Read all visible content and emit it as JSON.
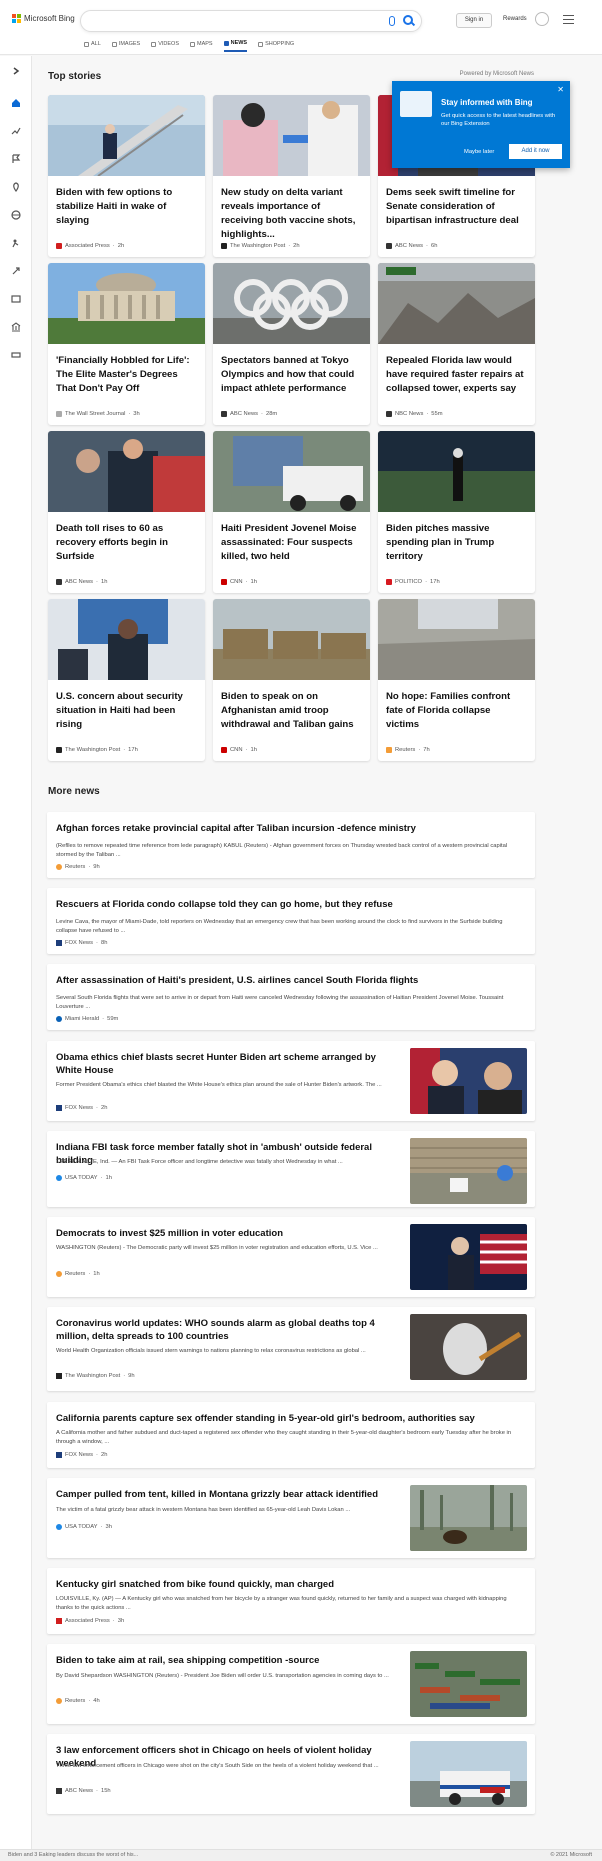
{
  "header": {
    "brand": "Microsoft Bing",
    "signin_label": "Sign in",
    "rewards_label": "Rewards",
    "tabs": [
      {
        "label": "ALL",
        "icon": "search-icon"
      },
      {
        "label": "IMAGES",
        "icon": "image-icon"
      },
      {
        "label": "VIDEOS",
        "icon": "video-icon"
      },
      {
        "label": "MAPS",
        "icon": "map-pin-icon"
      },
      {
        "label": "NEWS",
        "icon": "news-icon"
      },
      {
        "label": "SHOPPING",
        "icon": "tag-icon"
      }
    ],
    "active_tab": "NEWS"
  },
  "top_stories": {
    "title": "Top stories",
    "powered": "Powered by Microsoft News",
    "cards": [
      {
        "title": "Biden with few options to stabilize Haiti in wake of slaying",
        "source": "Associated Press",
        "age": "2h",
        "logo_color": "#d11e1e"
      },
      {
        "title": "New study on delta variant reveals importance of receiving both vaccine shots, highlights...",
        "source": "The Washington Post",
        "age": "2h",
        "logo_color": "#222222"
      },
      {
        "title": "Dems seek swift timeline for Senate consideration of bipartisan infrastructure deal",
        "source": "ABC News",
        "age": "6h",
        "logo_color": "#333333"
      },
      {
        "title": "'Financially Hobbled for Life': The Elite Master's Degrees That Don't Pay Off",
        "source": "The Wall Street Journal",
        "age": "3h",
        "logo_color": "#aaaaaa"
      },
      {
        "title": "Spectators banned at Tokyo Olympics and how that could impact athlete performance",
        "source": "ABC News",
        "age": "28m",
        "logo_color": "#333333"
      },
      {
        "title": "Repealed Florida law would have required faster repairs at collapsed tower, experts say",
        "source": "NBC News",
        "age": "55m",
        "logo_color": "#333333"
      },
      {
        "title": "Death toll rises to 60 as recovery efforts begin in Surfside",
        "source": "ABC News",
        "age": "1h",
        "logo_color": "#333333"
      },
      {
        "title": "Haiti President Jovenel Moise assassinated: Four suspects killed, two held",
        "source": "CNN",
        "age": "1h",
        "logo_color": "#cc0000"
      },
      {
        "title": "Biden pitches massive spending plan in Trump territory",
        "source": "POLITICO",
        "age": "17h",
        "logo_color": "#d71920"
      },
      {
        "title": "U.S. concern about security situation in Haiti had been rising",
        "source": "The Washington Post",
        "age": "17h",
        "logo_color": "#222222"
      },
      {
        "title": "Biden to speak on on Afghanistan amid troop withdrawal and Taliban gains",
        "source": "CNN",
        "age": "1h",
        "logo_color": "#cc0000"
      },
      {
        "title": "No hope: Families confront fate of Florida collapse victims",
        "source": "Reuters",
        "age": "7h",
        "logo_color": "#f39c37"
      }
    ]
  },
  "popup": {
    "title": "Stay informed with Bing",
    "body": "Get quick access to the latest headlines with our Bing Extension",
    "later_label": "Maybe later",
    "add_label": "Add it now",
    "close_glyph": "✕"
  },
  "more_news": {
    "title": "More news",
    "items": [
      {
        "title": "Afghan forces retake provincial capital after Taliban incursion -defence ministry",
        "desc": "(Reflles to remove repeated time reference from lede paragraph) KABUL (Reuters) - Afghan government forces on Thursday wrested back control of a western provincial capital stormed by the Taliban ...",
        "source": "Reuters",
        "age": "9h",
        "logo_color": "#f39c37"
      },
      {
        "title": "Rescuers at Florida condo collapse told they can go home, but they refuse",
        "desc": "Levine Cava, the mayor of Miami-Dade, told reporters on Wednesday that an emergency crew that has been working around the clock to find survivors in the Surfside building collapse have refused to ...",
        "source": "FOX News",
        "age": "8h",
        "logo_color": "#1d3d7a"
      },
      {
        "title": "After assassination of Haiti's president, U.S. airlines cancel South Florida flights",
        "desc": "Several South Florida flights that were set to arrive in or depart from Haiti were canceled Wednesday following the assassination of Haitian President Jovenel Moise. Toussaint Louverture ...",
        "source": "Miami Herald",
        "age": "59m",
        "logo_color": "#0a61b6"
      },
      {
        "title": "Obama ethics chief blasts secret Hunter Biden art scheme arranged by White House",
        "desc": "Former President Obama's ethics chief blasted the White House's ethics plan around the sale of Hunter Biden's artwork. The ...",
        "source": "FOX News",
        "age": "2h",
        "logo_color": "#1d3d7a"
      },
      {
        "title": "Indiana FBI task force member fatally shot in 'ambush' outside federal building",
        "desc": "TERRE HAUTE, Ind. — An FBI Task Force officer and longtime detective was fatally shot Wednesday in what ...",
        "source": "USA TODAY",
        "age": "1h",
        "logo_color": "#1e88e5"
      },
      {
        "title": "Democrats to invest $25 million in voter education",
        "desc": "WASHINGTON (Reuters) - The Democratic party will invest $25 million in voter registration and education efforts, U.S. Vice ...",
        "source": "Reuters",
        "age": "1h",
        "logo_color": "#f39c37"
      },
      {
        "title": "Coronavirus world updates: WHO sounds alarm as global deaths top 4 million, delta spreads to 100 countries",
        "desc": "World Health Organization officials issued stern warnings to nations planning to relax coronavirus restrictions as global ...",
        "source": "The Washington Post",
        "age": "9h",
        "logo_color": "#222222"
      },
      {
        "title": "California parents capture sex offender standing in 5-year-old girl's bedroom, authorities say",
        "desc": "A California mother and father subdued and duct-taped a registered sex offender who they caught standing in their 5-year-old daughter's bedroom early Tuesday after he broke in through a window, ...",
        "source": "FOX News",
        "age": "2h",
        "logo_color": "#1d3d7a"
      },
      {
        "title": "Camper pulled from tent, killed in Montana grizzly bear attack identified",
        "desc": "The victim of a fatal grizzly bear attack in western Montana has been identified as 65-year-old Leah Davis Lokan ...",
        "source": "USA TODAY",
        "age": "3h",
        "logo_color": "#1e88e5"
      },
      {
        "title": "Kentucky girl snatched from bike found quickly, man charged",
        "desc": "LOUISVILLE, Ky. (AP) — A Kentucky girl who was snatched from her bicycle by a stranger was found quickly, returned to her family and a suspect was charged with kidnapping thanks to the quick actions ...",
        "source": "Associated Press",
        "age": "3h",
        "logo_color": "#d11e1e"
      },
      {
        "title": "Biden to take aim at rail, sea shipping competition -source",
        "desc": "By David Shepardson WASHINGTON (Reuters) - President Joe Biden will order U.S. transportation agencies in coming days to ...",
        "source": "Reuters",
        "age": "4h",
        "logo_color": "#f39c37"
      },
      {
        "title": "3 law enforcement officers shot in Chicago on heels of violent holiday weekend",
        "desc": "Three law enforcement officers in Chicago were shot on the city's South Side on the heels of a violent holiday weekend that ...",
        "source": "ABC News",
        "age": "15h",
        "logo_color": "#333333"
      }
    ]
  },
  "footer": {
    "left": "Biden and 3 Eaking leaders discuss the worst of his...",
    "right": "© 2021 Microsoft"
  }
}
